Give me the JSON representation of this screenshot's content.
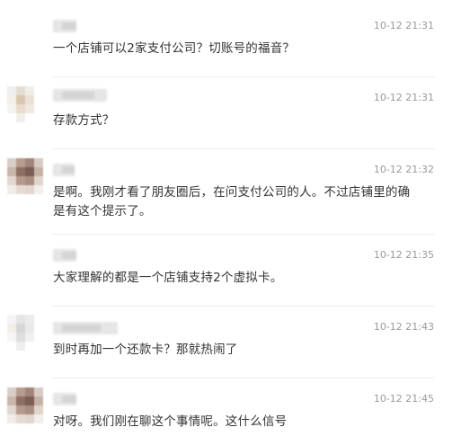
{
  "comments": [
    {
      "time": "10-12 21:31",
      "text": "一个店铺可以2家支付公司？切账号的福音？",
      "avatar": null
    },
    {
      "time": "10-12 21:31",
      "text": "存款方式？",
      "avatar": [
        "#efefee",
        "#e4ddd2",
        "#f0ece6",
        "#ffffff",
        "#f3f0ea",
        "#d8c7b0",
        "#e9e1d5",
        "#ffffff",
        "#f6f4f1",
        "#e7dccd",
        "#efe9e0",
        "#ffffff",
        "#ffffff",
        "#f2eee8",
        "#ffffff",
        "#ffffff"
      ]
    },
    {
      "time": "10-12 21:32",
      "text": "是啊。我刚才看了朋友圈后，在问支付公司的人。不过店铺里的确是有这个提示了。",
      "avatar": [
        "#d9cfc8",
        "#b69d8e",
        "#a2857a",
        "#d7ccc4",
        "#c9b6ab",
        "#8e6f63",
        "#7a5d53",
        "#c5b2a7",
        "#e3d8d0",
        "#b49a8d",
        "#a98d80",
        "#e0d4cc",
        "#f1ece8",
        "#e6dbd3",
        "#e2d6ce",
        "#f3efec"
      ]
    },
    {
      "time": "10-12 21:35",
      "text": "大家理解的都是一个店铺支持2个虚拟卡。",
      "avatar": null
    },
    {
      "time": "10-12 21:43",
      "text": "到时再加一个还款卡？那就热闹了",
      "avatar": [
        "#f4f4f4",
        "#e4e4e4",
        "#ececec",
        "#ffffff",
        "#f2efea",
        "#d6d6d6",
        "#e9e9e9",
        "#ffffff",
        "#f7f6f4",
        "#dedede",
        "#f0f0f0",
        "#ffffff",
        "#ffffff",
        "#eeeeee",
        "#ffffff",
        "#ffffff"
      ]
    },
    {
      "time": "10-12 21:45",
      "text": "对呀。我们刚在聊这个事情呢。这什么信号",
      "avatar": [
        "#d9cfc8",
        "#b69d8e",
        "#a2857a",
        "#d7ccc4",
        "#c9b6ab",
        "#8e6f63",
        "#7a5d53",
        "#c5b2a7",
        "#e3d8d0",
        "#b49a8d",
        "#a98d80",
        "#e0d4cc",
        "#f1ece8",
        "#e6dbd3",
        "#e2d6ce",
        "#f3efec"
      ]
    }
  ]
}
